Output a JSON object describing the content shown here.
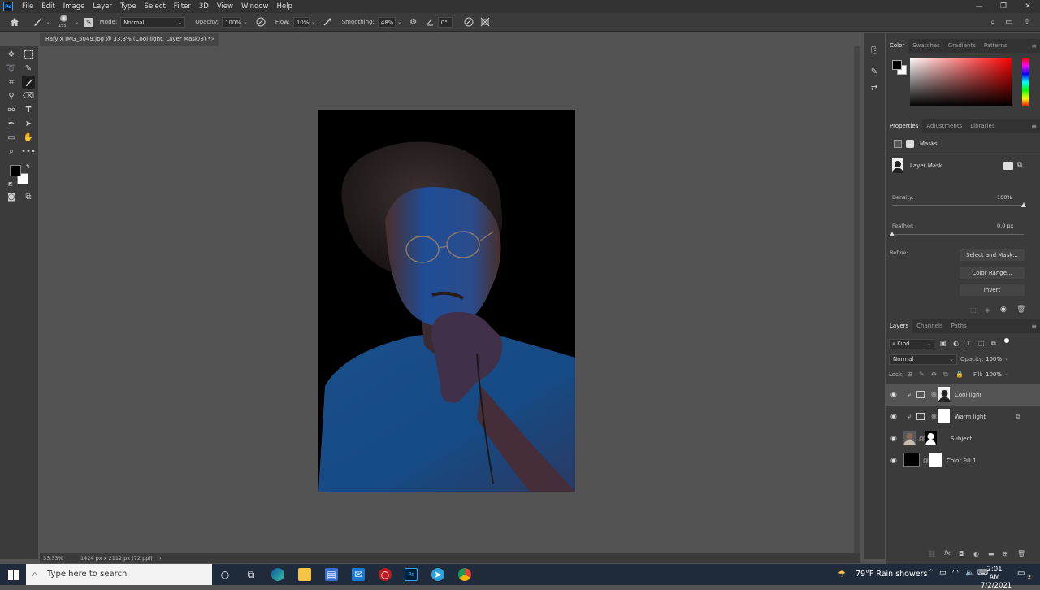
{
  "menubar": {
    "logo": "Ps",
    "items": [
      "File",
      "Edit",
      "Image",
      "Layer",
      "Type",
      "Select",
      "Filter",
      "3D",
      "View",
      "Window",
      "Help"
    ]
  },
  "optionsbar": {
    "brush_size": "155",
    "mode_label": "Mode:",
    "mode_value": "Normal",
    "opacity_label": "Opacity:",
    "opacity_value": "100%",
    "flow_label": "Flow:",
    "flow_value": "10%",
    "smoothing_label": "Smoothing:",
    "smoothing_value": "48%",
    "angle_value": "0°"
  },
  "document": {
    "tab_title": "Rafy x IMG_5049.jpg @ 33.3% (Cool light, Layer Mask/8) *",
    "zoom": "33.33%",
    "dimensions": "1424 px x 2112 px (72 ppi)"
  },
  "color_panel": {
    "tabs": [
      "Color",
      "Swatches",
      "Gradients",
      "Patterns"
    ],
    "hue": "#ff0000"
  },
  "properties_panel": {
    "tabs": [
      "Properties",
      "Adjustments",
      "Libraries"
    ],
    "section": "Masks",
    "mask_label": "Layer Mask",
    "density_label": "Density:",
    "density_value": "100%",
    "density_level": 1.0,
    "feather_label": "Feather:",
    "feather_value": "0.0 px",
    "feather_level": 0.0,
    "refine_label": "Refine:",
    "select_and_mask": "Select and Mask...",
    "color_range": "Color Range...",
    "invert": "Invert"
  },
  "layers_panel": {
    "tabs": [
      "Layers",
      "Channels",
      "Paths"
    ],
    "filter_kind": "Kind",
    "blend_mode": "Normal",
    "opacity_label": "Opacity:",
    "opacity_value": "100%",
    "lock_label": "Lock:",
    "fill_label": "Fill:",
    "fill_value": "100%",
    "layers": [
      {
        "name": "Cool light",
        "selected": true
      },
      {
        "name": "Warm light",
        "selected": false
      },
      {
        "name": "Subject",
        "selected": false
      },
      {
        "name": "Color Fill 1",
        "selected": false
      }
    ]
  },
  "taskbar": {
    "search_placeholder": "Type here to search",
    "weather": "79°F  Rain showers",
    "time": "2:01 AM",
    "date": "7/2/2021",
    "notification_count": "2"
  }
}
